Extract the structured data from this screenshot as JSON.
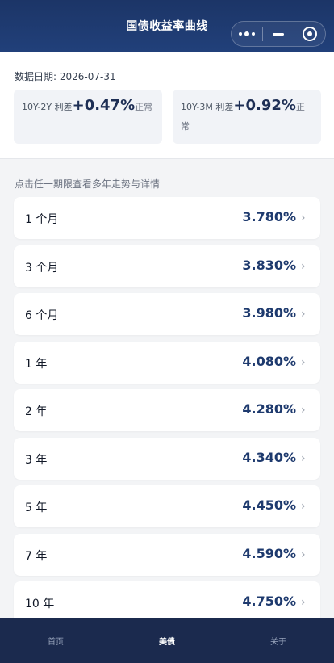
{
  "header": {
    "title": "国债收益率曲线",
    "capsule_icons": [
      "more-dots-icon",
      "minimize-icon",
      "target-icon"
    ]
  },
  "info": {
    "date_label": "数据日期: 2026-07-31",
    "spreads": [
      {
        "label": "10Y-2Y 利差",
        "value": "+0.47%",
        "status": "正常"
      },
      {
        "label": "10Y-3M 利差",
        "value": "+0.92%",
        "status": "正常"
      }
    ]
  },
  "hint": "点击任一期限查看多年走势与详情",
  "yields": [
    {
      "term": "1 个月",
      "rate": "3.780%"
    },
    {
      "term": "3 个月",
      "rate": "3.830%"
    },
    {
      "term": "6 个月",
      "rate": "3.980%"
    },
    {
      "term": "1 年",
      "rate": "4.080%"
    },
    {
      "term": "2 年",
      "rate": "4.280%"
    },
    {
      "term": "3 年",
      "rate": "4.340%"
    },
    {
      "term": "5 年",
      "rate": "4.450%"
    },
    {
      "term": "7 年",
      "rate": "4.590%"
    },
    {
      "term": "10 年",
      "rate": "4.750%"
    }
  ],
  "chevron": "›",
  "tabs": [
    {
      "label": "首页",
      "active": false
    },
    {
      "label": "美债",
      "active": true
    },
    {
      "label": "关于",
      "active": false
    }
  ]
}
